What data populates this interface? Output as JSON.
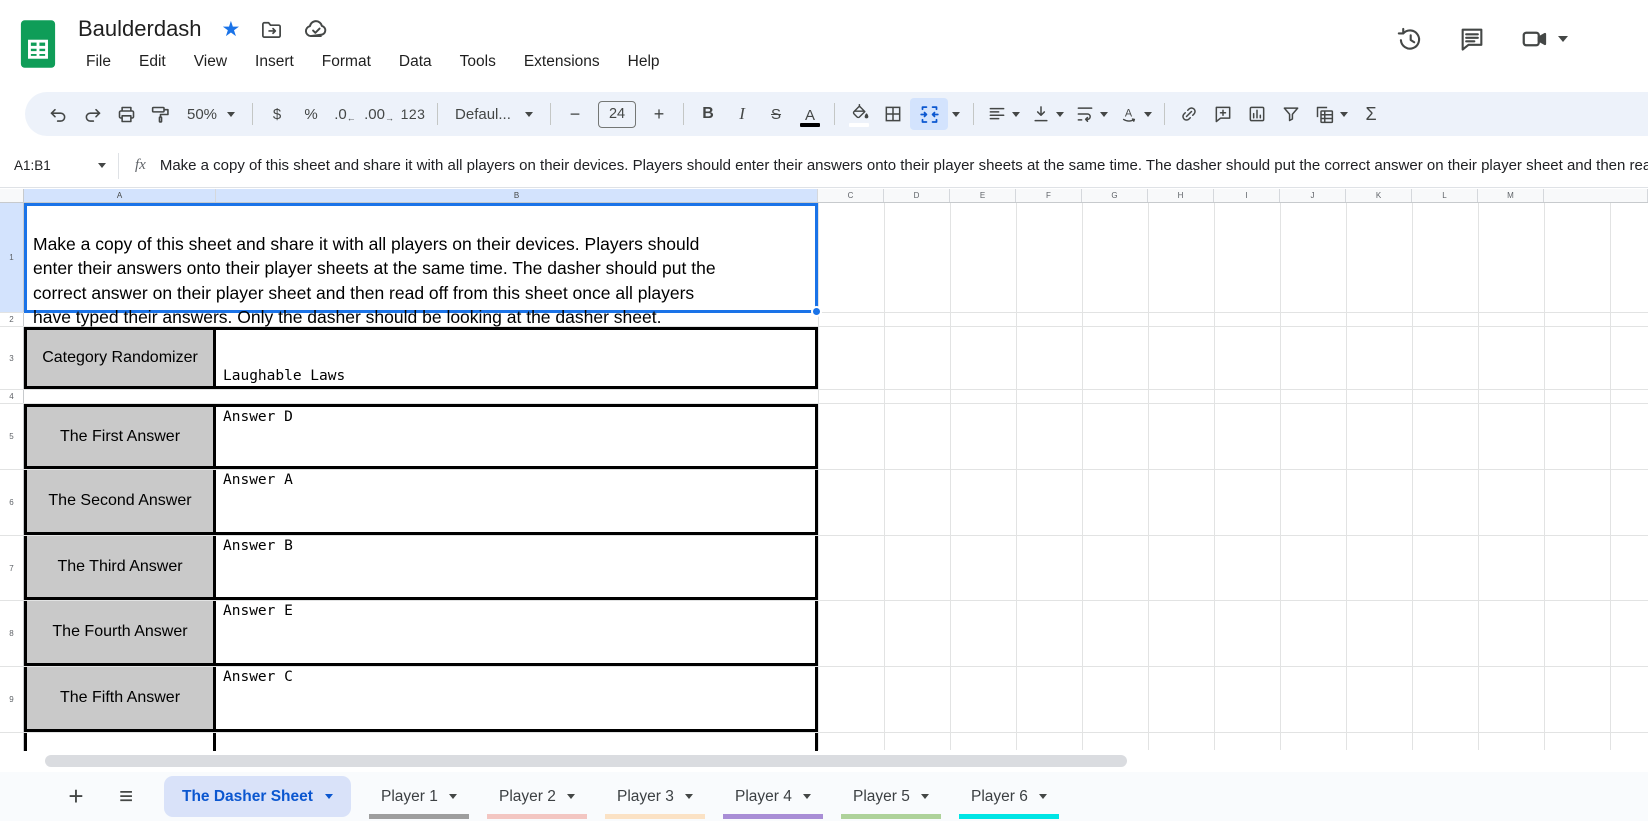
{
  "titlebar": {
    "title": "Baulderdash",
    "menus": [
      "File",
      "Edit",
      "View",
      "Insert",
      "Format",
      "Data",
      "Tools",
      "Extensions",
      "Help"
    ]
  },
  "toolbar": {
    "zoom": "50%",
    "currency": "$",
    "percent": "%",
    "decrease_decimal": ".0",
    "increase_decimal": ".00",
    "more_formats": "123",
    "font_name": "Defaul...",
    "decrease_size": "−",
    "font_size": "24",
    "increase_size": "+",
    "bold": "B",
    "italic": "I",
    "strikethrough": "S",
    "text_color": "A",
    "sum": "Σ"
  },
  "formula_bar": {
    "name_box": "A1:B1",
    "fx_label": "fx"
  },
  "grid": {
    "column_headers": [
      "A",
      "B",
      "C",
      "D",
      "E",
      "F",
      "G",
      "H",
      "I",
      "J",
      "K",
      "L",
      "M"
    ],
    "row_numbers": [
      "1",
      "2",
      "3",
      "4",
      "5",
      "6",
      "7",
      "8",
      "9"
    ],
    "instructions": "Make a copy of this sheet and share it with all players on their devices. Players should\nenter their answers onto their player sheets at the same time. The dasher should put the\ncorrect answer on their player sheet and then read off from this sheet once all players\nhave typed their answers. Only the dasher should be looking at the dasher sheet.",
    "category_row": {
      "label": "Category Randomizer",
      "value": "Laughable Laws"
    },
    "answer_rows": [
      {
        "label": "The First Answer",
        "value": "Answer D"
      },
      {
        "label": "The Second Answer",
        "value": "Answer A"
      },
      {
        "label": "The Third Answer",
        "value": "Answer B"
      },
      {
        "label": "The Fourth Answer",
        "value": "Answer E"
      },
      {
        "label": "The Fifth Answer",
        "value": "Answer C"
      }
    ]
  },
  "tabs": {
    "add": "+",
    "menu": "≡",
    "active_label": "The Dasher Sheet",
    "players": [
      {
        "label": "Player 1",
        "color": "#9e9e9e"
      },
      {
        "label": "Player 2",
        "color": "#f3c6c2"
      },
      {
        "label": "Player 3",
        "color": "#fbe2c5"
      },
      {
        "label": "Player 4",
        "color": "#a98ed6"
      },
      {
        "label": "Player 5",
        "color": "#aed29a"
      },
      {
        "label": "Player 6",
        "color": "#00e5e5"
      }
    ]
  },
  "colors": {
    "accent_blue": "#0b57d0",
    "selection_blue": "#1a73e8",
    "gray_cell": "#c9c9c9",
    "toolbar_bg": "#edf2fa",
    "logo_green": "#0f9d58"
  }
}
